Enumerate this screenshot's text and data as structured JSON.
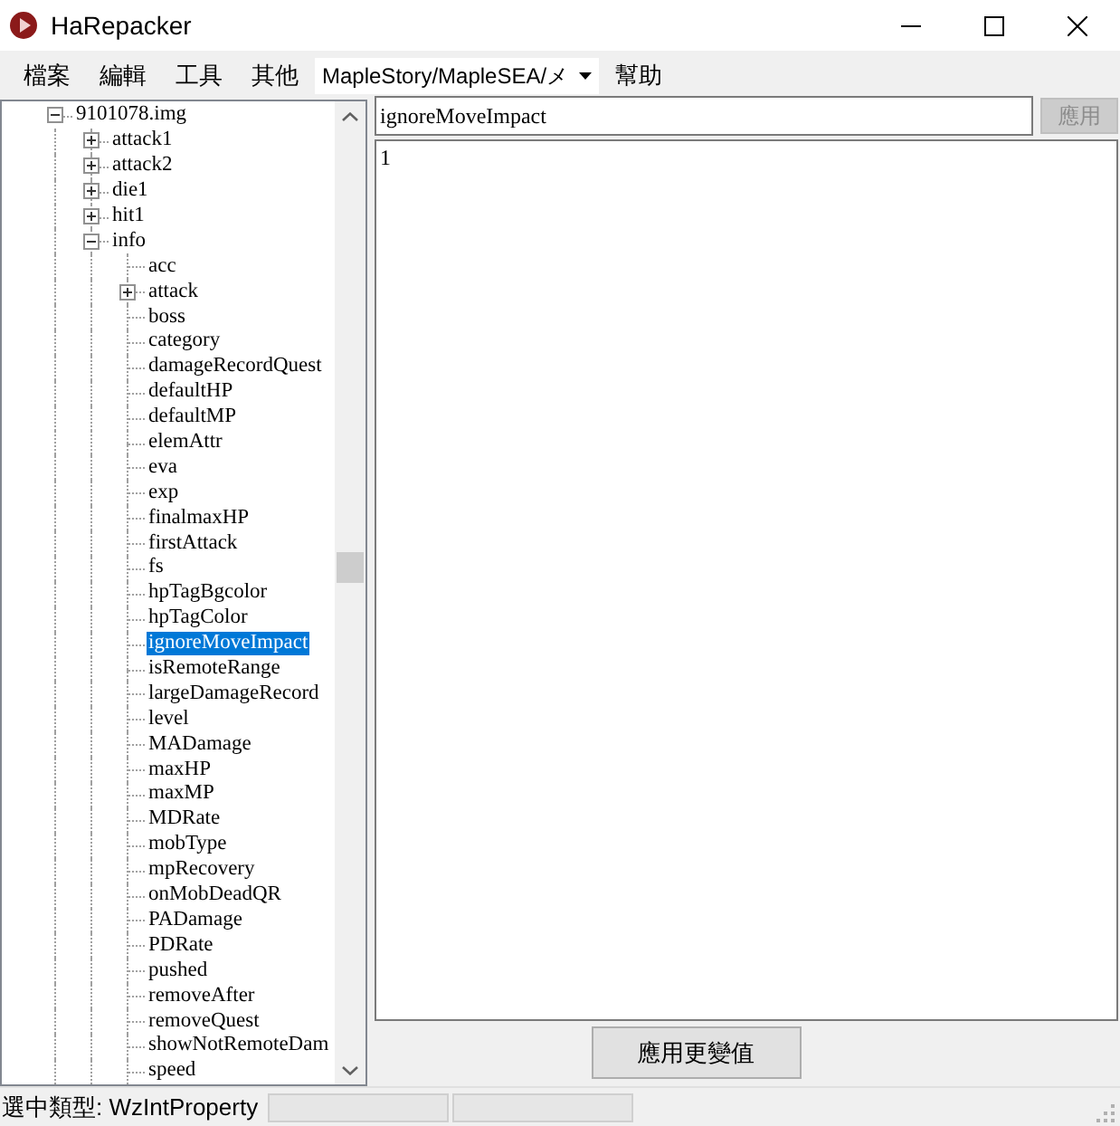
{
  "window": {
    "title": "HaRepacker"
  },
  "menu": [
    {
      "label": "檔案"
    },
    {
      "label": "編輯"
    },
    {
      "label": "工具"
    },
    {
      "label": "其他"
    },
    {
      "kind": "combo",
      "label": "MapleStory/MapleSEA/メ"
    },
    {
      "label": "幫助"
    }
  ],
  "tree": [
    {
      "label": "9101078.img",
      "kind": "node",
      "expanded": true,
      "selected": false,
      "children": [
        {
          "label": "attack1",
          "kind": "node",
          "expanded": false,
          "selected": false
        },
        {
          "label": "attack2",
          "kind": "node",
          "expanded": false,
          "selected": false
        },
        {
          "label": "die1",
          "kind": "node",
          "expanded": false,
          "selected": false
        },
        {
          "label": "hit1",
          "kind": "node",
          "expanded": false,
          "selected": false
        },
        {
          "label": "info",
          "kind": "node",
          "expanded": true,
          "selected": false,
          "children": [
            {
              "label": "acc",
              "kind": "leaf",
              "selected": false
            },
            {
              "label": "attack",
              "kind": "node",
              "expanded": false,
              "selected": false
            },
            {
              "label": "boss",
              "kind": "leaf",
              "selected": false
            },
            {
              "label": "category",
              "kind": "leaf",
              "selected": false
            },
            {
              "label": "damageRecordQuest",
              "kind": "leaf",
              "selected": false
            },
            {
              "label": "defaultHP",
              "kind": "leaf",
              "selected": false
            },
            {
              "label": "defaultMP",
              "kind": "leaf",
              "selected": false
            },
            {
              "label": "elemAttr",
              "kind": "leaf",
              "selected": false
            },
            {
              "label": "eva",
              "kind": "leaf",
              "selected": false
            },
            {
              "label": "exp",
              "kind": "leaf",
              "selected": false
            },
            {
              "label": "finalmaxHP",
              "kind": "leaf",
              "selected": false
            },
            {
              "label": "firstAttack",
              "kind": "leaf",
              "selected": false
            },
            {
              "label": "fs",
              "kind": "leaf",
              "selected": false
            },
            {
              "label": "hpTagBgcolor",
              "kind": "leaf",
              "selected": false
            },
            {
              "label": "hpTagColor",
              "kind": "leaf",
              "selected": false
            },
            {
              "label": "ignoreMoveImpact",
              "kind": "leaf",
              "selected": true
            },
            {
              "label": "isRemoteRange",
              "kind": "leaf",
              "selected": false
            },
            {
              "label": "largeDamageRecord",
              "kind": "leaf",
              "selected": false
            },
            {
              "label": "level",
              "kind": "leaf",
              "selected": false
            },
            {
              "label": "MADamage",
              "kind": "leaf",
              "selected": false
            },
            {
              "label": "maxHP",
              "kind": "leaf",
              "selected": false
            },
            {
              "label": "maxMP",
              "kind": "leaf",
              "selected": false
            },
            {
              "label": "MDRate",
              "kind": "leaf",
              "selected": false
            },
            {
              "label": "mobType",
              "kind": "leaf",
              "selected": false
            },
            {
              "label": "mpRecovery",
              "kind": "leaf",
              "selected": false
            },
            {
              "label": "onMobDeadQR",
              "kind": "leaf",
              "selected": false
            },
            {
              "label": "PADamage",
              "kind": "leaf",
              "selected": false
            },
            {
              "label": "PDRate",
              "kind": "leaf",
              "selected": false
            },
            {
              "label": "pushed",
              "kind": "leaf",
              "selected": false
            },
            {
              "label": "removeAfter",
              "kind": "leaf",
              "selected": false
            },
            {
              "label": "removeQuest",
              "kind": "leaf",
              "selected": false
            },
            {
              "label": "showNotRemoteDam",
              "kind": "leaf",
              "selected": false
            },
            {
              "label": "speed",
              "kind": "leaf",
              "selected": false
            }
          ]
        }
      ]
    }
  ],
  "name_field": {
    "value": "ignoreMoveImpact"
  },
  "apply_button": {
    "label": "應用",
    "disabled": true
  },
  "value_area": {
    "value": "1"
  },
  "apply_changes_button": {
    "label": "應用更變值"
  },
  "status_bar": {
    "text": "選中類型: WzIntProperty"
  }
}
